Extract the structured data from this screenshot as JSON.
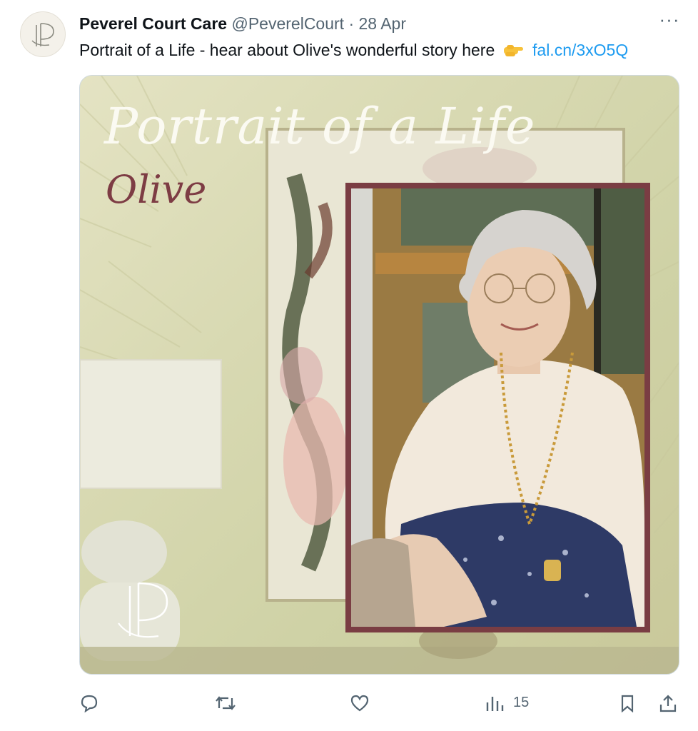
{
  "tweet": {
    "display_name": "Peverel Court Care",
    "handle": "@PeverelCourt",
    "separator": "·",
    "date": "28 Apr",
    "more_label": "···",
    "text": "Portrait of a Life - hear about Olive's wonderful story here",
    "emoji": "backhand-index-pointing-right",
    "link": "fal.cn/3xO5Q"
  },
  "media": {
    "title": "Portrait of a Life",
    "subtitle": "Olive"
  },
  "actions": {
    "views_count": "15"
  },
  "colors": {
    "link": "#1d9bf0",
    "muted": "#536471",
    "frame": "#7a3d43",
    "subtitle": "#7d3c44"
  }
}
